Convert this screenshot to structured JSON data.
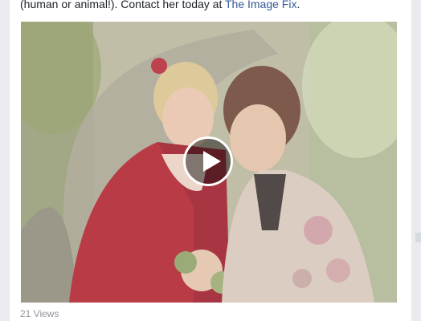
{
  "post": {
    "caption_text": "(human or animal!). Contact her today at ",
    "caption_link": "The Image Fix",
    "caption_end": ".",
    "views": "21 Views"
  },
  "video": {
    "play_icon": "play-icon",
    "subject": "photo of two women in front of a tree"
  },
  "colors": {
    "link": "#365899",
    "text": "#1d2129",
    "meta": "#90949c",
    "background": "#e9ebee"
  }
}
